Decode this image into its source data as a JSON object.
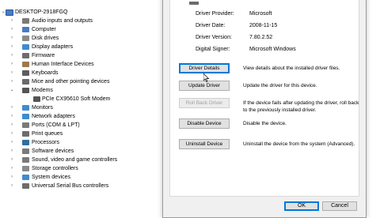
{
  "tree": {
    "root": "DESKTOP-2918FGQ",
    "items": [
      {
        "label": "Audio inputs and outputs",
        "color": "#7a7a7a",
        "expanded": false,
        "level": 1
      },
      {
        "label": "Computer",
        "color": "#4a7bc4",
        "expanded": false,
        "level": 1
      },
      {
        "label": "Disk drives",
        "color": "#8a8a8a",
        "expanded": false,
        "level": 1
      },
      {
        "label": "Display adapters",
        "color": "#3f8bd0",
        "expanded": false,
        "level": 1
      },
      {
        "label": "Firmware",
        "color": "#6d6d6d",
        "expanded": false,
        "level": 1
      },
      {
        "label": "Human Interface Devices",
        "color": "#9a7b4f",
        "expanded": false,
        "level": 1
      },
      {
        "label": "Keyboards",
        "color": "#5d5d5d",
        "expanded": false,
        "level": 1
      },
      {
        "label": "Mice and other pointing devices",
        "color": "#6a6a6a",
        "expanded": false,
        "level": 1
      },
      {
        "label": "Modems",
        "color": "#555555",
        "expanded": true,
        "level": 1
      },
      {
        "label": "PCIe CX95610 Soft Modem",
        "color": "#555555",
        "expanded": null,
        "level": 2
      },
      {
        "label": "Monitors",
        "color": "#3f8bd0",
        "expanded": false,
        "level": 1
      },
      {
        "label": "Network adapters",
        "color": "#3f8bd0",
        "expanded": false,
        "level": 1
      },
      {
        "label": "Ports (COM & LPT)",
        "color": "#7a7a7a",
        "expanded": false,
        "level": 1
      },
      {
        "label": "Print queues",
        "color": "#6d6d6d",
        "expanded": false,
        "level": 1
      },
      {
        "label": "Processors",
        "color": "#2f6f9f",
        "expanded": false,
        "level": 1
      },
      {
        "label": "Software devices",
        "color": "#7a7a7a",
        "expanded": false,
        "level": 1
      },
      {
        "label": "Sound, video and game controllers",
        "color": "#7a7a7a",
        "expanded": false,
        "level": 1
      },
      {
        "label": "Storage controllers",
        "color": "#8a8a8a",
        "expanded": false,
        "level": 1
      },
      {
        "label": "System devices",
        "color": "#3f8bd0",
        "expanded": false,
        "level": 1
      },
      {
        "label": "Universal Serial Bus controllers",
        "color": "#6d6d6d",
        "expanded": false,
        "level": 1
      }
    ]
  },
  "dialog": {
    "info": [
      {
        "label": "Driver Provider:",
        "value": "Microsoft"
      },
      {
        "label": "Driver Date:",
        "value": "2008-11-15"
      },
      {
        "label": "Driver Version:",
        "value": "7.80.2.52"
      },
      {
        "label": "Digital Signer:",
        "value": "Microsoft Windows"
      }
    ],
    "actions": [
      {
        "button": "Driver Details",
        "description": "View details about the installed driver files.",
        "state": "focused"
      },
      {
        "button": "Update Driver",
        "description": "Update the driver for this device.",
        "state": "normal"
      },
      {
        "button": "Roll Back Driver",
        "description": "If the device fails after updating the driver, roll back to the previously installed driver.",
        "state": "disabled"
      },
      {
        "button": "Disable Device",
        "description": "Disable the device.",
        "state": "normal"
      },
      {
        "button": "Uninstall Device",
        "description": "Uninstall the device from the system (Advanced).",
        "state": "normal"
      }
    ],
    "footer": {
      "ok": "OK",
      "cancel": "Cancel"
    }
  }
}
